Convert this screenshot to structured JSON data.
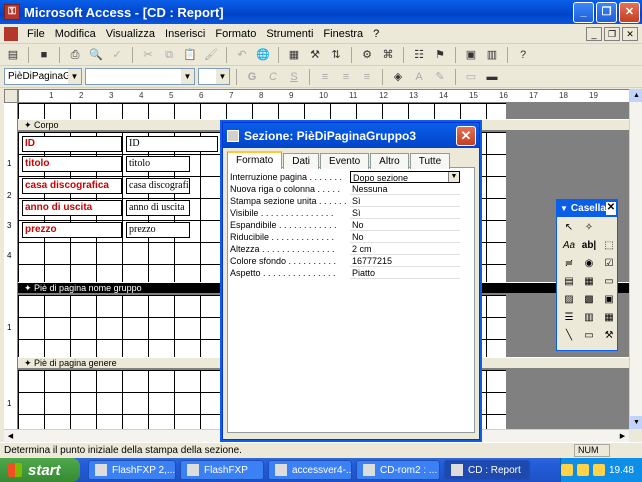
{
  "window": {
    "title": "Microsoft Access - [CD : Report]",
    "min": "_",
    "max": "❐",
    "close": "✕"
  },
  "menu": [
    "File",
    "Modifica",
    "Visualizza",
    "Inserisci",
    "Formato",
    "Strumenti",
    "Finestra",
    "?"
  ],
  "mdi": {
    "min": "_",
    "restore": "❐",
    "close": "✕"
  },
  "toolbar2": {
    "object_combo": "PièDiPaginaGru",
    "font_combo": "",
    "size_combo": "",
    "bold": "G",
    "italic": "C",
    "underline": "S"
  },
  "ruler": {
    "ticks": [
      "1",
      "2",
      "3",
      "4",
      "5",
      "6",
      "7",
      "8",
      "9",
      "10",
      "11",
      "12",
      "13",
      "14",
      "15",
      "16",
      "17",
      "18",
      "19"
    ]
  },
  "vruler": {
    "ticks": [
      "1",
      "2",
      "3",
      "4",
      "1",
      "1"
    ]
  },
  "sections": {
    "corpo": "Corpo",
    "pie_gruppo": "Piè di pagina nome gruppo",
    "pie_genere": "Piè di pagina genere"
  },
  "fields": [
    {
      "label": "ID",
      "value": "ID"
    },
    {
      "label": "titolo",
      "value": "titolo"
    },
    {
      "label": "casa discografica",
      "value": "casa discografica"
    },
    {
      "label": "anno di uscita",
      "value": "anno di uscita"
    },
    {
      "label": "prezzo",
      "value": "prezzo"
    }
  ],
  "dialog": {
    "title": "Sezione: PièDiPaginaGruppo3",
    "close": "✕",
    "tabs": [
      "Formato",
      "Dati",
      "Evento",
      "Altro",
      "Tutte"
    ],
    "active_tab": "Formato",
    "properties": [
      {
        "name": "Interruzione pagina . . . . . . .",
        "value": "Dopo sezione"
      },
      {
        "name": "Nuova riga o colonna . . . . .",
        "value": "Nessuna"
      },
      {
        "name": "Stampa sezione unita . . . . . .",
        "value": "Sì"
      },
      {
        "name": "Visibile . . . . . . . . . . . . . . .",
        "value": "Sì"
      },
      {
        "name": "Espandibile . . . . . . . . . . . .",
        "value": "No"
      },
      {
        "name": "Riducibile . . . . . . . . . . . . .",
        "value": "No"
      },
      {
        "name": "Altezza . . . . . . . . . . . . . . .",
        "value": "2 cm"
      },
      {
        "name": "Colore sfondo . . . . . . . . . .",
        "value": "16777215"
      },
      {
        "name": "Aspetto . . . . . . . . . . . . . . .",
        "value": "Piatto"
      }
    ]
  },
  "toolbox": {
    "title": "Casella",
    "close": "✕"
  },
  "status": {
    "text": "Determina il punto iniziale della stampa della sezione.",
    "num": "NUM"
  },
  "taskbar": {
    "start": "start",
    "tasks": [
      {
        "label": "FlashFXP 2,..."
      },
      {
        "label": "FlashFXP"
      },
      {
        "label": "accessver4-..."
      },
      {
        "label": "CD-rom2 : ..."
      },
      {
        "label": "CD : Report"
      }
    ],
    "clock": "19.48"
  }
}
